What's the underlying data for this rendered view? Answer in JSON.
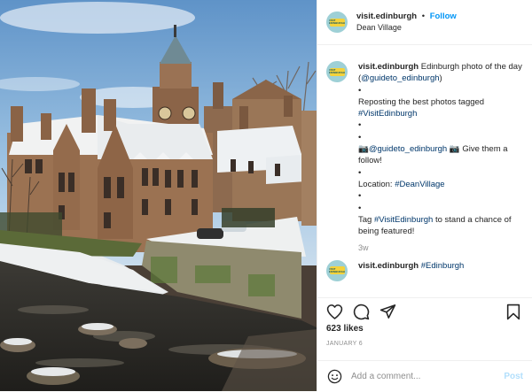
{
  "post": {
    "image": {
      "subject": "Dean Village, Edinburgh — stone buildings with snowy roofs beside the Water of Leith"
    },
    "header": {
      "username": "visit.edinburgh",
      "separator": "•",
      "follow_label": "Follow",
      "location": "Dean Village"
    },
    "avatar_text": "VISIT EDINBURGH",
    "caption": {
      "username": "visit.edinburgh",
      "lines": [
        "Edinburgh photo of the day (",
        "@guideto_edinburgh",
        ")",
        "•",
        "Reposting the best photos tagged",
        "#VisitEdinburgh",
        "•",
        "•",
        "📷",
        "@guideto_edinburgh",
        "📷",
        "Give them a follow!",
        "•",
        "Location:",
        "#DeanVillage",
        "•",
        "•",
        "Tag",
        "#VisitEdinburgh",
        "to stand a chance of being featured!"
      ],
      "time_ago": "3w"
    },
    "next_comment": {
      "username": "visit.edinburgh",
      "text": "#Edinburgh"
    },
    "likes": "623 likes",
    "date": "JANUARY 6",
    "add_comment": {
      "placeholder": "Add a comment...",
      "post_label": "Post"
    }
  },
  "colors": {
    "link": "#00376b",
    "follow": "#0095f6",
    "post_disabled": "#b2dffc",
    "muted": "#8e8e8e"
  },
  "icons": [
    "heart-icon",
    "comment-icon",
    "share-icon",
    "bookmark-icon",
    "emoji-icon"
  ]
}
